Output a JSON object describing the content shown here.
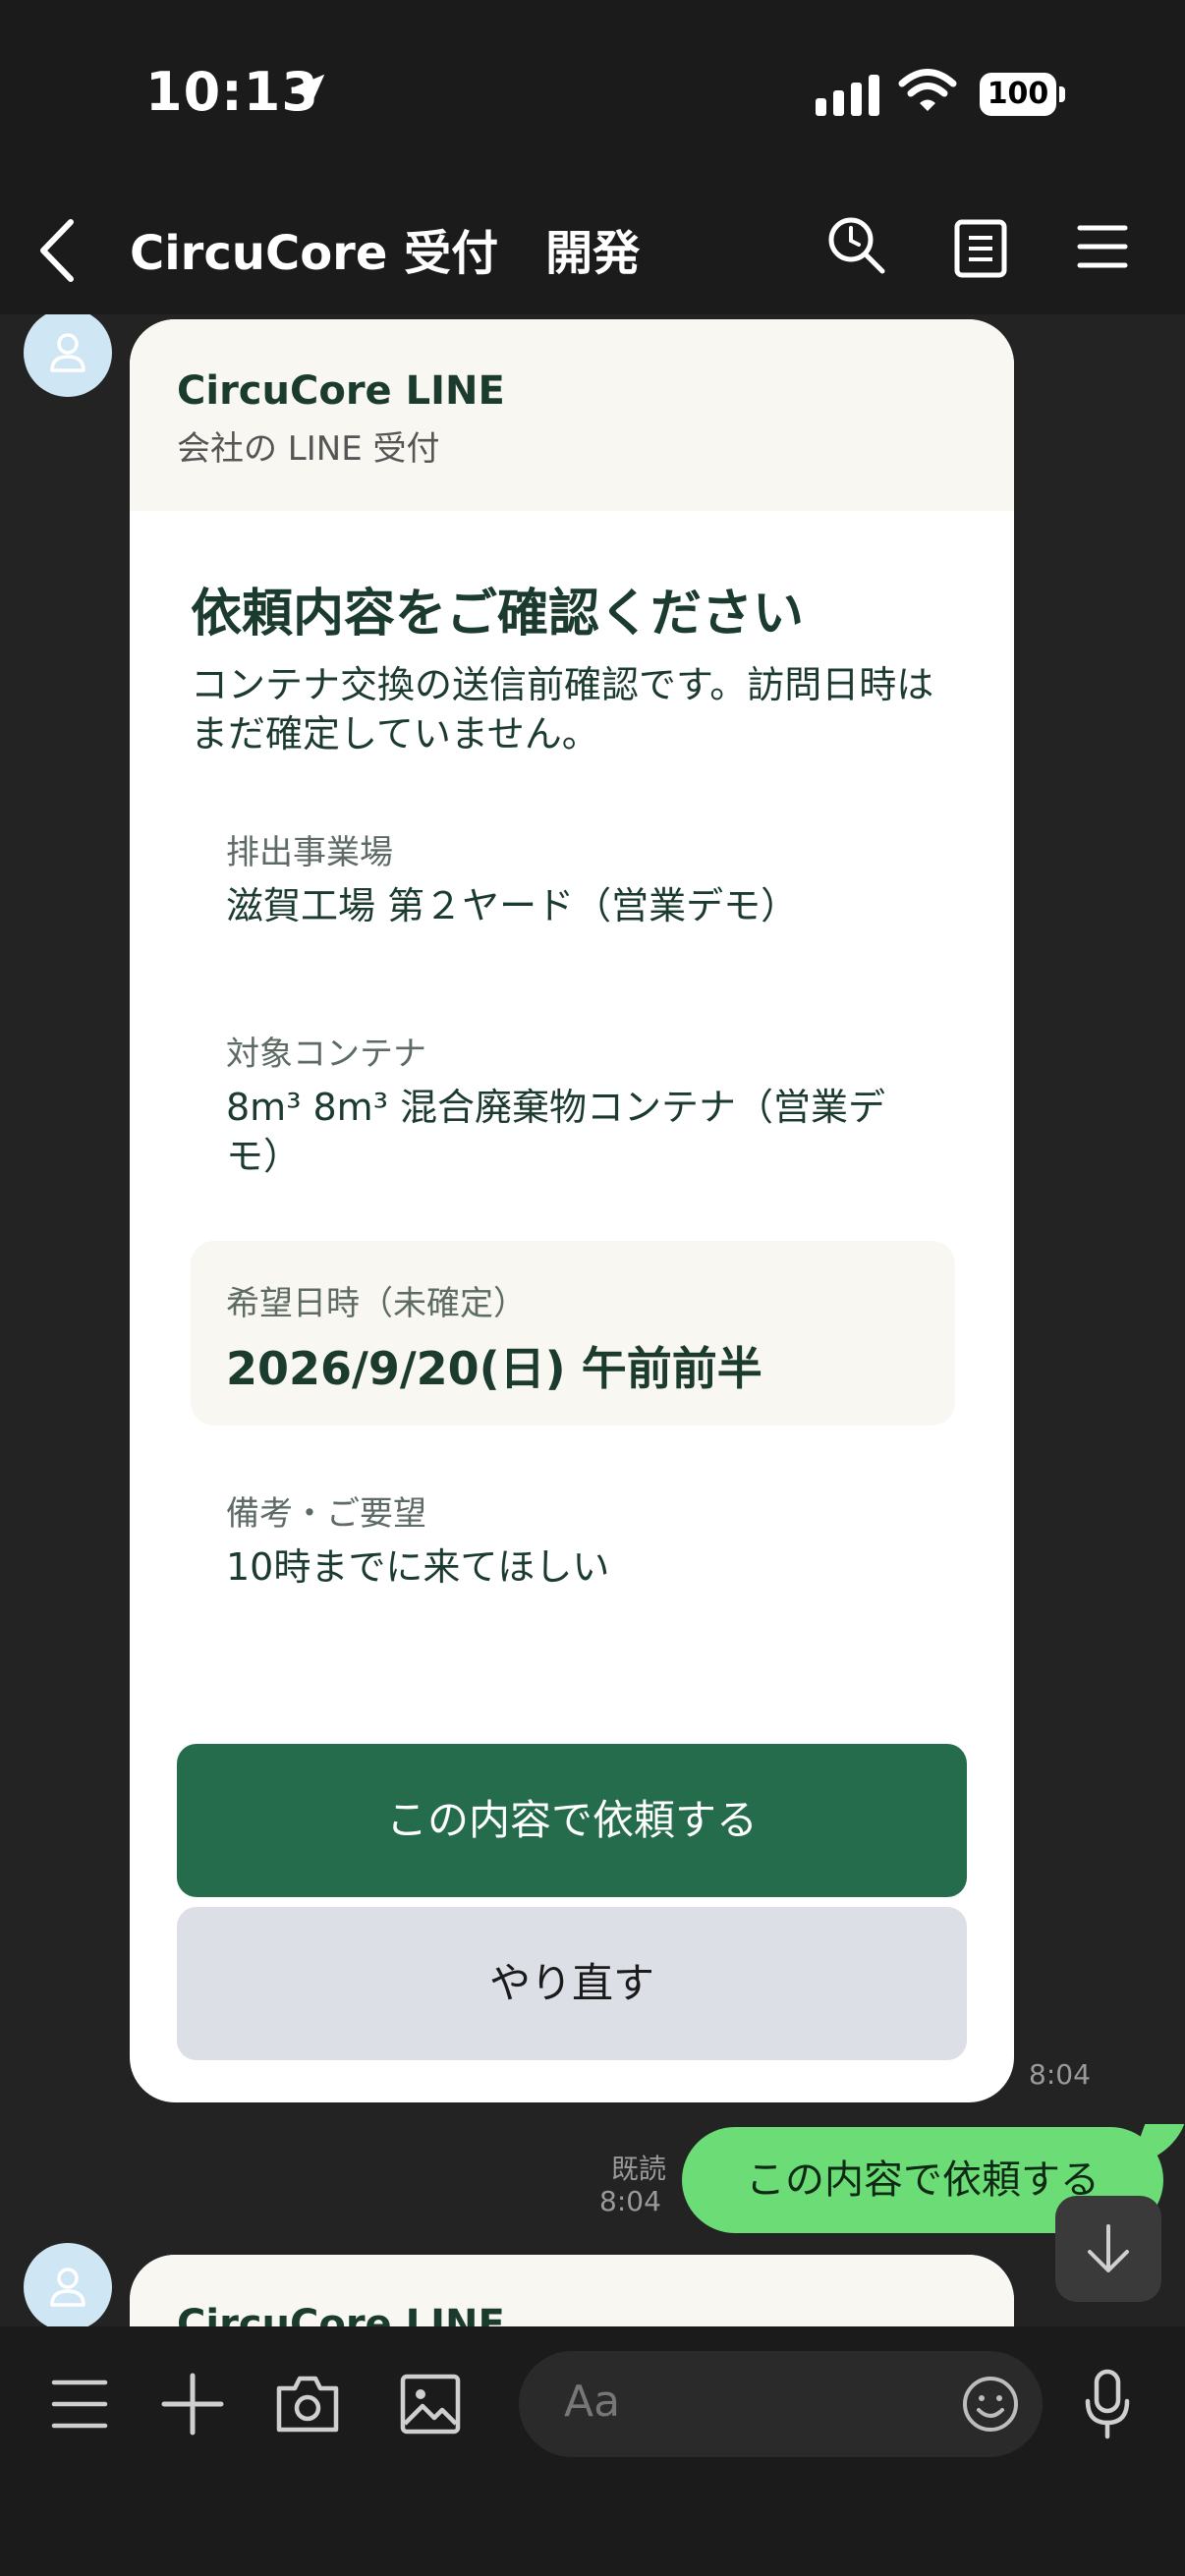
{
  "status_bar": {
    "time": "10:13",
    "battery": "100"
  },
  "header": {
    "title": "CircuCore 受付　開発"
  },
  "card": {
    "brand": "CircuCore LINE",
    "brand_sub": "会社の LINE 受付",
    "heading": "依頼内容をご確認ください",
    "intro": "コンテナ交換の送信前確認です。訪問日時はまだ確定していません。",
    "fields": [
      {
        "label": "排出事業場",
        "value": "滋賀工場 第２ヤード（営業デモ）"
      },
      {
        "label": "対象コンテナ",
        "value": "8m³ 8m³ 混合廃棄物コンテナ（営業デモ）"
      }
    ],
    "date": {
      "label": "希望日時（未確定）",
      "value": "2026/9/20(日) 午前前半"
    },
    "note": {
      "label": "備考・ご要望",
      "value": "10時までに来てほしい"
    },
    "primary_button": "この内容で依頼する",
    "secondary_button": "やり直す"
  },
  "card_time": "8:04",
  "my_message": {
    "read": "既読",
    "time": "8:04",
    "text": "この内容で依頼する"
  },
  "next_card": {
    "brand": "CircuCore LINE"
  },
  "input": {
    "placeholder": "Aa"
  },
  "icons": [
    "location-arrow-icon",
    "signal-icon",
    "wifi-icon",
    "back-chevron-icon",
    "search-icon",
    "note-icon",
    "menu-icon",
    "avatar-icon",
    "arrow-down-icon",
    "hamburger-icon",
    "plus-icon",
    "camera-icon",
    "image-icon",
    "emoji-icon",
    "microphone-icon"
  ]
}
